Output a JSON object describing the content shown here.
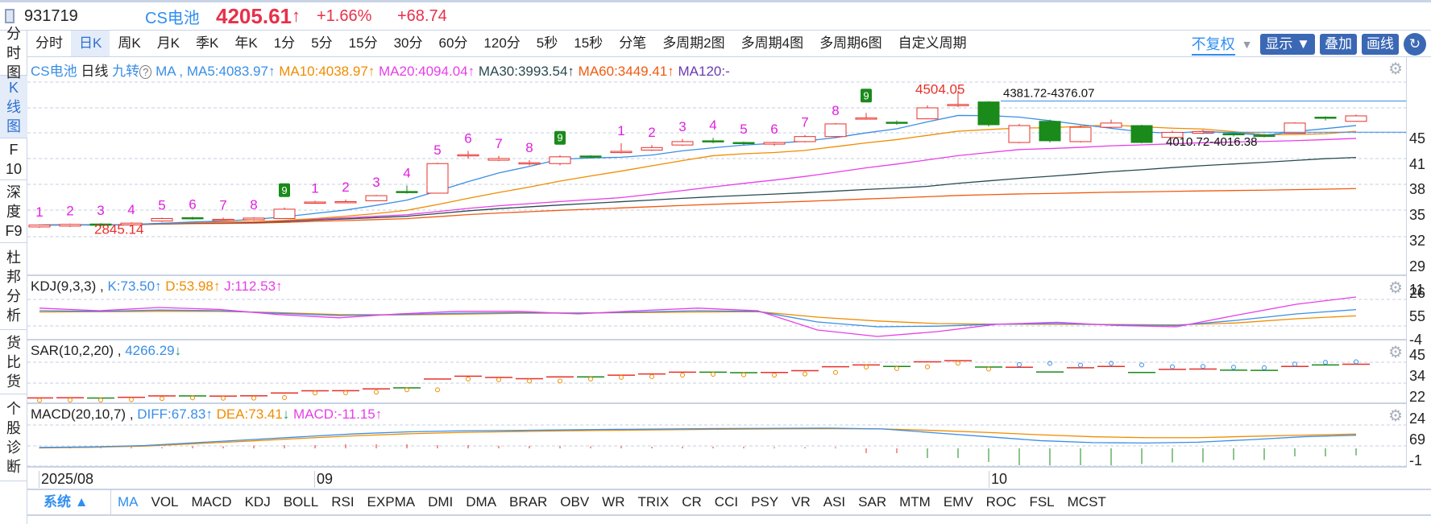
{
  "header": {
    "code": "931719",
    "name": "CS电池",
    "price": "4205.61",
    "arrow": "↑",
    "pct": "+1.66%",
    "change": "+68.74"
  },
  "sidebar": [
    {
      "l1": "分",
      "l2": "时",
      "l3": "图"
    },
    {
      "l1": "K",
      "l2": "线",
      "l3": "图",
      "selected": true
    },
    {
      "l1": "F",
      "l2": "10"
    },
    {
      "l1": "深",
      "l2": "度",
      "l3": "F9"
    },
    {
      "l1": "杜",
      "l2": "邦",
      "l3": "分",
      "l4": "析"
    },
    {
      "l1": "货",
      "l2": "比",
      "l3": "货"
    },
    {
      "l1": "个",
      "l2": "股",
      "l3": "诊",
      "l4": "断"
    }
  ],
  "periods": [
    "分时",
    "日K",
    "周K",
    "月K",
    "季K",
    "年K",
    "1分",
    "5分",
    "15分",
    "30分",
    "60分",
    "120分",
    "5秒",
    "15秒",
    "分笔",
    "多周期2图",
    "多周期4图",
    "多周期6图",
    "自定义周期"
  ],
  "selected_period": "日K",
  "toolbar": {
    "fuquan": "不复权",
    "display": "显示",
    "overlay": "叠加",
    "draw": "画线"
  },
  "main_header": {
    "name": "CS电池",
    "type": "日线",
    "nine": "九转",
    "ma": "MA ,",
    "ma5": "MA5:4083.97↑",
    "ma10": "MA10:4038.97↑",
    "ma20": "MA20:4094.04↑",
    "ma30": "MA30:3993.54↑",
    "ma60": "MA60:3449.41↑",
    "ma120": "MA120:-"
  },
  "kdj_header": {
    "name": "KDJ(9,3,3) ,",
    "k": "K:73.50↑",
    "d": "D:53.98↑",
    "j": "J:112.53↑"
  },
  "sar_header": {
    "name": "SAR(10,2,20) ,",
    "v": "4266.29",
    "arrow": "↓"
  },
  "macd_header": {
    "name": "MACD(20,10,7) ,",
    "diff": "DIFF:67.83↑",
    "dea": "DEA:73.41",
    "dea_arrow": "↓",
    "macd": "MACD:-11.15↑"
  },
  "axis_labels": {
    "main": [
      "45",
      "41",
      "38",
      "35",
      "32",
      "29",
      "26"
    ],
    "kdj": [
      "11",
      "55",
      "-4"
    ],
    "sar": [
      "45",
      "34",
      "22"
    ],
    "macd": [
      "24",
      "69",
      "-1"
    ]
  },
  "dates": [
    "2025/08",
    "09",
    "10"
  ],
  "tabs": {
    "system": "系统 ▲",
    "items": [
      "MA",
      "VOL",
      "MACD",
      "KDJ",
      "BOLL",
      "RSI",
      "EXPMA",
      "DMI",
      "DMA",
      "BRAR",
      "OBV",
      "WR",
      "TRIX",
      "CR",
      "CCI",
      "PSY",
      "VR",
      "ASI",
      "SAR",
      "MTM",
      "EMV",
      "ROC",
      "FSL",
      "MCST"
    ]
  },
  "colors": {
    "up": "#e8302a",
    "down": "#1a8a1a",
    "ma5": "#3a8ee6",
    "ma10": "#f08c00",
    "ma20": "#e83ee8",
    "ma30": "#2a4a50",
    "ma60": "#f05a10",
    "nine": "#e020e0"
  },
  "chart_data": {
    "type": "candlestick",
    "annotations": {
      "low": "2845.14",
      "high": "4504.05",
      "hline1": "4381.72-4376.07",
      "hline2": "4010.72-4016.38"
    },
    "candles": [
      [
        2890,
        2912,
        2880,
        2920
      ],
      [
        2900,
        2920,
        2890,
        2930
      ],
      [
        2925,
        2910,
        2890,
        2935
      ],
      [
        2915,
        2935,
        2905,
        2945
      ],
      [
        2960,
        2990,
        2950,
        3000
      ],
      [
        3000,
        2990,
        2975,
        3010
      ],
      [
        2970,
        2980,
        2960,
        3000
      ],
      [
        2975,
        2995,
        2965,
        3005
      ],
      [
        2990,
        3100,
        2985,
        3120
      ],
      [
        3175,
        3185,
        3165,
        3200
      ],
      [
        3180,
        3190,
        3170,
        3215
      ],
      [
        3200,
        3260,
        3195,
        3270
      ],
      [
        3310,
        3300,
        3285,
        3380
      ],
      [
        3290,
        3640,
        3285,
        3650
      ],
      [
        3740,
        3745,
        3700,
        3790
      ],
      [
        3680,
        3700,
        3670,
        3730
      ],
      [
        3640,
        3650,
        3620,
        3680
      ],
      [
        3640,
        3720,
        3620,
        3740
      ],
      [
        3730,
        3720,
        3700,
        3740
      ],
      [
        3770,
        3785,
        3760,
        3880
      ],
      [
        3800,
        3830,
        3790,
        3860
      ],
      [
        3860,
        3900,
        3850,
        3930
      ],
      [
        3910,
        3900,
        3880,
        3945
      ],
      [
        3890,
        3880,
        3860,
        3900
      ],
      [
        3870,
        3890,
        3850,
        3900
      ],
      [
        3900,
        3960,
        3890,
        3980
      ],
      [
        3960,
        4110,
        3950,
        4120
      ],
      [
        4170,
        4180,
        4160,
        4240
      ],
      [
        4130,
        4120,
        4100,
        4150
      ],
      [
        4170,
        4300,
        4165,
        4330
      ],
      [
        4330,
        4340,
        4310,
        4504
      ],
      [
        4370,
        4100,
        4080,
        4380
      ],
      [
        3890,
        4090,
        3880,
        4110
      ],
      [
        4140,
        3910,
        3890,
        4160
      ],
      [
        3900,
        4070,
        3890,
        4090
      ],
      [
        4070,
        4120,
        4060,
        4160
      ],
      [
        4090,
        3890,
        3880,
        4100
      ],
      [
        3950,
        4010,
        3930,
        4030
      ],
      [
        4000,
        4020,
        3990,
        4040
      ],
      [
        3995,
        3980,
        3960,
        4010
      ],
      [
        3975,
        3970,
        3950,
        3990
      ],
      [
        4000,
        4120,
        3995,
        4130
      ],
      [
        4190,
        4180,
        4150,
        4200
      ],
      [
        4140,
        4205,
        4135,
        4220
      ]
    ],
    "nine_turn": [
      "1",
      "2",
      "3",
      "4",
      "5",
      "6",
      "7",
      "8",
      "9",
      "1",
      "2",
      "3",
      "4",
      "5",
      "6",
      "7",
      "8",
      "9",
      "",
      "1",
      "2",
      "3",
      "4",
      "5",
      "6",
      "7",
      "8",
      "9"
    ],
    "kdj": {
      "k": [
        70,
        68,
        72,
        70,
        62,
        55,
        58,
        62,
        64,
        62,
        66,
        70,
        68,
        35,
        20,
        22,
        28,
        30,
        26,
        24,
        40,
        60,
        73.5
      ],
      "d": [
        66,
        67,
        68,
        68,
        64,
        58,
        57,
        59,
        62,
        63,
        64,
        66,
        67,
        50,
        38,
        30,
        28,
        28,
        27,
        26,
        32,
        45,
        53.98
      ],
      "j": [
        78,
        70,
        80,
        74,
        58,
        48,
        60,
        68,
        68,
        60,
        70,
        78,
        70,
        10,
        -10,
        5,
        28,
        34,
        24,
        20,
        56,
        90,
        112.53
      ]
    },
    "macd": {
      "diff": [
        5,
        8,
        15,
        30,
        45,
        60,
        75,
        85,
        90,
        92,
        95,
        98,
        100,
        102,
        103,
        104,
        100,
        80,
        60,
        40,
        30,
        28,
        32,
        45,
        60,
        67.83
      ],
      "dea": [
        3,
        6,
        12,
        25,
        38,
        52,
        65,
        75,
        82,
        86,
        90,
        93,
        96,
        98,
        100,
        101,
        100,
        92,
        82,
        70,
        60,
        55,
        55,
        62,
        68,
        73.41
      ]
    }
  }
}
